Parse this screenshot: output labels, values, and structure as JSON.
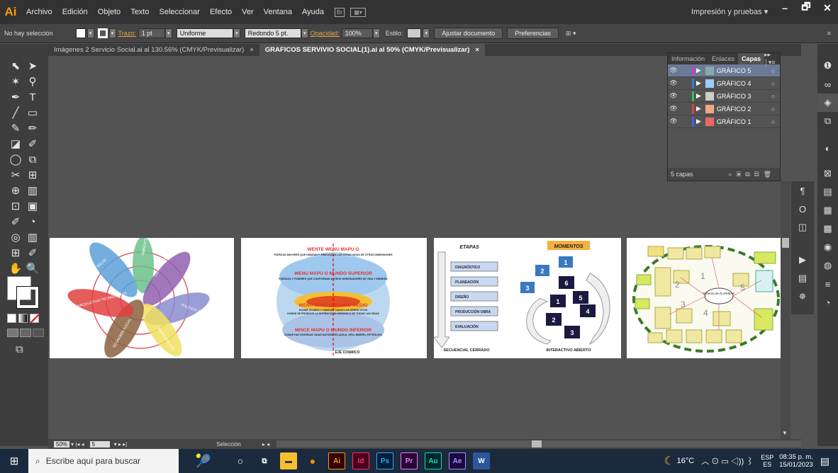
{
  "app": {
    "logo": "Ai"
  },
  "menu": [
    "Archivo",
    "Edición",
    "Objeto",
    "Texto",
    "Seleccionar",
    "Efecto",
    "Ver",
    "Ventana",
    "Ayuda"
  ],
  "menubar_icons": [
    "Br",
    "▦▾"
  ],
  "workspace": "Impresión y pruebas  ▾",
  "window_buttons": [
    "–",
    "🗗",
    "✕"
  ],
  "control": {
    "selection": "No hay selección",
    "stroke_label": "Trazo:",
    "stroke_weight": "1 pt",
    "profile": "Uniforme",
    "brush": "Redondo 5 pt.",
    "opacity_label": "Opacidad:",
    "opacity": "100%",
    "style_label": "Estilo:",
    "fit_button": "Ajustar documento",
    "prefs_button": "Preferencias"
  },
  "tabs": [
    {
      "label": "Imágenes 2 Servicio Social.ai al 130.56% (CMYK/Previsualizar)",
      "close": "×"
    },
    {
      "label": "GRAFICOS SERVIVIO SOCIAL(1).ai al 50% (CMYK/Previsualizar)",
      "close": "×"
    }
  ],
  "tools": [
    "⬉",
    "➤",
    "✶",
    "⚲",
    "✒",
    "T",
    "╱",
    "▭",
    "✎",
    "✏",
    "◪",
    "✐",
    "◯",
    "⧉",
    "✂",
    "⊞",
    "⊕",
    "▥",
    "⊡",
    "▣",
    "✐",
    "◔",
    "◎",
    "▥",
    "⊞",
    "✐",
    "✋",
    "🔍"
  ],
  "layers_panel": {
    "tabs": [
      "Información",
      "Enlaces",
      "Capas"
    ],
    "menu": "▸▸ │▾≡",
    "layers": [
      {
        "name": "GRÁFICO 5",
        "color": "#c23fd4",
        "thumb": "#8aa"
      },
      {
        "name": "GRÁFICO 4",
        "color": "#3a7ae0",
        "thumb": "#9cf"
      },
      {
        "name": "GRÁFICO 3",
        "color": "#30c05a",
        "thumb": "#ccc"
      },
      {
        "name": "GRÁFICO 2",
        "color": "#e04040",
        "thumb": "#ea8"
      },
      {
        "name": "GRÁFICO 1",
        "color": "#4060e0",
        "thumb": "#e66"
      }
    ],
    "count": "5 capas"
  },
  "artboard2": {
    "t1": "WENTE WENU MAPU O",
    "t1sub": "FUERZAS MAYORES QUE HABITAN Y ARMONIZAN LAS OTRAS VIDAS DE OTRAS DIMENSIONES",
    "t2": "WENU MAPU O MUNDO SUPERIOR",
    "t2sub": "FUERZAS Y PODERES QUE CONFORMAN ASTROS GENERADORES DE VIDA Y ENERGÍA",
    "t3": "WENU MAPU O MUNDO MEDIO",
    "t3sub": "DONDE VIVIMOS Y HABITAN TODOS LOS SERES VIVOS",
    "t3sub2": "DONDE SE PRODUCE LA INTERACCIÓN ARMÓNICA DE TODAS LAS VIDAS",
    "t4": "MINCE MAPU O MUNDO INFERIOR",
    "t4sub": "DONDE HAY DIVERSAS VIDAS NATURALES (AGUA, ORO, MINERO, PETRÓLEO)",
    "axis": "EJE COSMICO"
  },
  "artboard1": {
    "petals": [
      "SALUD",
      "AMBIENTE",
      "CULTURA INTERCULTURALIDAD",
      "POLÍTICO SOCIAL",
      "PRODUCTIVO TECNOLÓGICO",
      "ECONOMÍA SOCIAL",
      "PARTICIPACIÓN"
    ]
  },
  "artboard3": {
    "etapas": "ETAPAS",
    "momentos": "MOMENTOS",
    "stages": [
      "DIAGNÓSTICO",
      "PLANEACIÓN",
      "DISEÑO",
      "PRODUCCIÓN OBRA",
      "EVALUACIÓN"
    ],
    "left_caption": "SECUENCIAL CERRADO",
    "right_caption": "INTERACTIVO ABIERTO",
    "boxes_blue": [
      "1",
      "2",
      "3"
    ],
    "boxes_dark": [
      "6",
      "5",
      "1",
      "4",
      "2",
      "3"
    ]
  },
  "artboard4": {
    "center": "Sistema de D=PME+C",
    "numbers": [
      "1",
      "2",
      "3",
      "4",
      "5"
    ]
  },
  "bottom": {
    "zoom": "50%",
    "page": "5",
    "tool": "Selección"
  },
  "taskbar": {
    "search": "Escribe aquí para buscar",
    "temp": "16°C",
    "lang": "ESP",
    "lang2": "ES",
    "time": "08:35 p. m.",
    "date": "15/01/2023",
    "apps": [
      "Ai",
      "Id",
      "Ps",
      "Pr",
      "Au",
      "Ae",
      "W"
    ]
  }
}
